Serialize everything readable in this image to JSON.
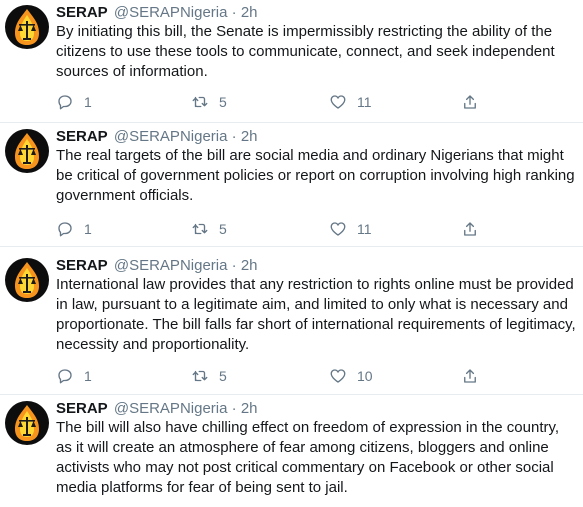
{
  "tweets": [
    {
      "name": "SERAP",
      "handle": "@SERAPNigeria",
      "separator": "·",
      "time": "2h",
      "text": "By initiating this bill, the Senate is impermissibly restricting the ability of the citizens to use these tools to communicate, connect, and seek independent sources of information.",
      "replies": "1",
      "retweets": "5",
      "likes": "11"
    },
    {
      "name": "SERAP",
      "handle": "@SERAPNigeria",
      "separator": "·",
      "time": "2h",
      "text": "The real targets of the bill are social media and ordinary Nigerians that might be critical of government policies or report on corruption involving high ranking government officials.",
      "replies": "1",
      "retweets": "5",
      "likes": "11"
    },
    {
      "name": "SERAP",
      "handle": "@SERAPNigeria",
      "separator": "·",
      "time": "2h",
      "text": "International law provides that any restriction to rights online must be provided in law, pursuant to a legitimate aim, and limited to only what is necessary and proportionate. The bill falls far short of international requirements of legitimacy, necessity and proportionality.",
      "replies": "1",
      "retweets": "5",
      "likes": "10"
    },
    {
      "name": "SERAP",
      "handle": "@SERAPNigeria",
      "separator": "·",
      "time": "2h",
      "text": "The bill will also have chilling effect on freedom of expression in the country, as it will create an atmosphere of fear among citizens, bloggers and online activists who may not post critical commentary on Facebook or other social media platforms for fear of being sent to jail."
    }
  ],
  "colors": {
    "text": "#14171a",
    "secondary": "#657786",
    "divider": "#e6ecf0",
    "avatar_bg": "#0d0d0d",
    "avatar_flame": "#f7941d"
  }
}
